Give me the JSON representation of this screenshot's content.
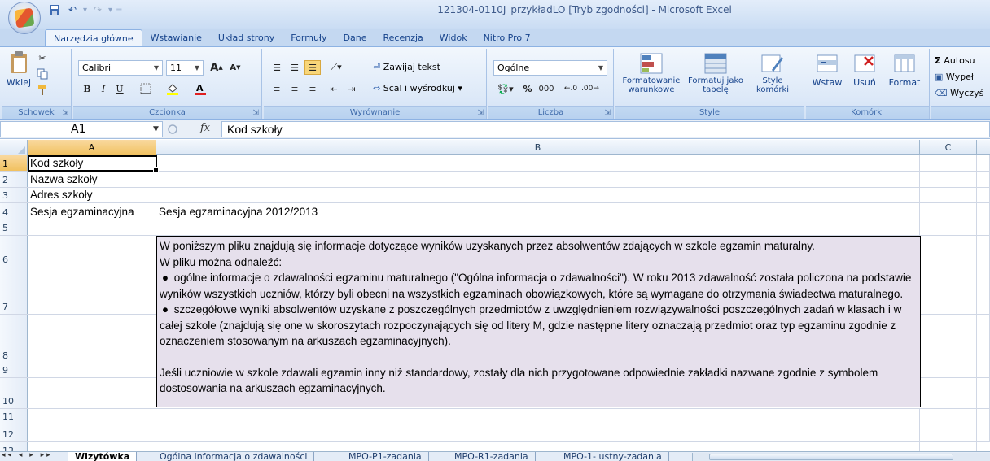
{
  "window": {
    "title": "121304-0110J_przykładLO  [Tryb zgodności] - Microsoft Excel"
  },
  "ribbon_tabs": [
    "Narzędzia główne",
    "Wstawianie",
    "Układ strony",
    "Formuły",
    "Dane",
    "Recenzja",
    "Widok",
    "Nitro Pro 7"
  ],
  "ribbon": {
    "clipboard": {
      "label": "Schowek",
      "paste": "Wklej"
    },
    "font": {
      "label": "Czcionka",
      "font_name": "Calibri",
      "font_size": "11",
      "bold": "B",
      "italic": "I",
      "underline": "U",
      "grow": "A",
      "shrink": "A"
    },
    "alignment": {
      "label": "Wyrównanie",
      "wrap": "Zawijaj tekst",
      "merge": "Scal i wyśrodkuj"
    },
    "number": {
      "label": "Liczba",
      "format": "Ogólne",
      "percent": "%",
      "thousands": "000"
    },
    "styles": {
      "label": "Style",
      "conditional": "Formatowanie warunkowe",
      "as_table": "Formatuj jako tabelę",
      "cell_styles": "Style komórki"
    },
    "cells": {
      "label": "Komórki",
      "insert": "Wstaw",
      "delete": "Usuń",
      "format": "Format"
    },
    "editing": {
      "autosum": "Autosu",
      "fill": "Wypeł",
      "clear": "Wyczyś"
    }
  },
  "formula_bar": {
    "name_box": "A1",
    "fx": "fx",
    "content": "Kod szkoły"
  },
  "columns": [
    "A",
    "B",
    "C"
  ],
  "rows": [
    {
      "num": "1",
      "a": "Kod szkoły",
      "b": ""
    },
    {
      "num": "2",
      "a": "Nazwa szkoły",
      "b": ""
    },
    {
      "num": "3",
      "a": "Adres szkoły",
      "b": ""
    },
    {
      "num": "4",
      "a": "Sesja egzaminacyjna",
      "b": "Sesja egzaminacyjna 2012/2013"
    },
    {
      "num": "5",
      "a": "",
      "b": ""
    },
    {
      "num": "6",
      "a": "",
      "b": ""
    },
    {
      "num": "7",
      "a": "",
      "b": ""
    },
    {
      "num": "8",
      "a": "",
      "b": ""
    },
    {
      "num": "9",
      "a": "",
      "b": ""
    },
    {
      "num": "10",
      "a": "",
      "b": ""
    },
    {
      "num": "11",
      "a": "",
      "b": ""
    },
    {
      "num": "12",
      "a": "",
      "b": ""
    },
    {
      "num": "13",
      "a": "",
      "b": ""
    }
  ],
  "info": {
    "line6a": "W poniższym pliku znajdują się informacje dotyczące wyników uzyskanych przez absolwentów zdających w szkole egzamin maturalny.",
    "line6b": "W pliku można odnaleźć:",
    "line7": "ogólne informacje o zdawalności egzaminu maturalnego (\"Ogólna informacja o zdawalności\"). W roku 2013 zdawalność została policzona na podstawie wyników wszystkich uczniów, którzy byli obecni na wszystkich egzaminach obowiązkowych, które są wymagane do otrzymania świadectwa maturalnego.",
    "line8": "szczegółowe wyniki absolwentów uzyskane z poszczególnych przedmiotów z uwzględnieniem rozwiązywalności poszczególnych zadań w klasach i w całej szkole (znajdują się one w skoroszytach rozpoczynających się od litery M, gdzie następne litery oznaczają przedmiot oraz typ egzaminu zgodnie z oznaczeniem stosowanym na arkuszach egzaminacyjnych).",
    "line10": "Jeśli uczniowie w szkole zdawali egzamin inny niż standardowy, zostały dla nich przygotowane odpowiednie zakładki nazwane zgodnie z symbolem dostosowania na arkuszach egzaminacyjnych.",
    "bullet": "●"
  },
  "sheets": [
    "Wizytówka",
    "Ogólna informacja o zdawalności",
    "MPO-P1-zadania",
    "MPO-R1-zadania",
    "MPO-1- ustny-zadania"
  ]
}
